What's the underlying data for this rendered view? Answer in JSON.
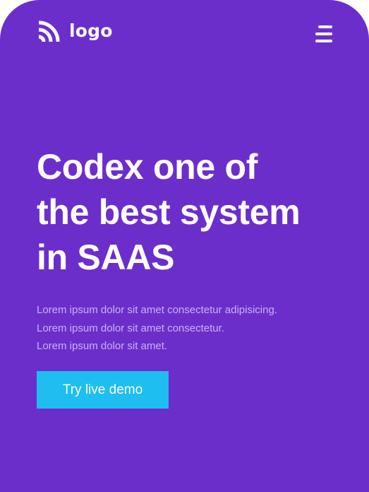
{
  "header": {
    "logo_text": "logo",
    "logo_icon": "rss-arcs-icon",
    "menu_icon": "hamburger-menu-icon"
  },
  "hero": {
    "title_lines": [
      "Codex one of",
      "the best system",
      "in SAAS"
    ],
    "description_lines": [
      "Lorem ipsum dolor sit amet consectetur adipisicing.",
      "Lorem ipsum dolor sit amet consectetur.",
      "Lorem ipsum dolor sit amet."
    ],
    "cta_label": "Try live demo"
  },
  "colors": {
    "background": "#6c2ecb",
    "text": "#ffffff",
    "description": "#c9b2ef",
    "cta_background": "#1ebef0"
  }
}
